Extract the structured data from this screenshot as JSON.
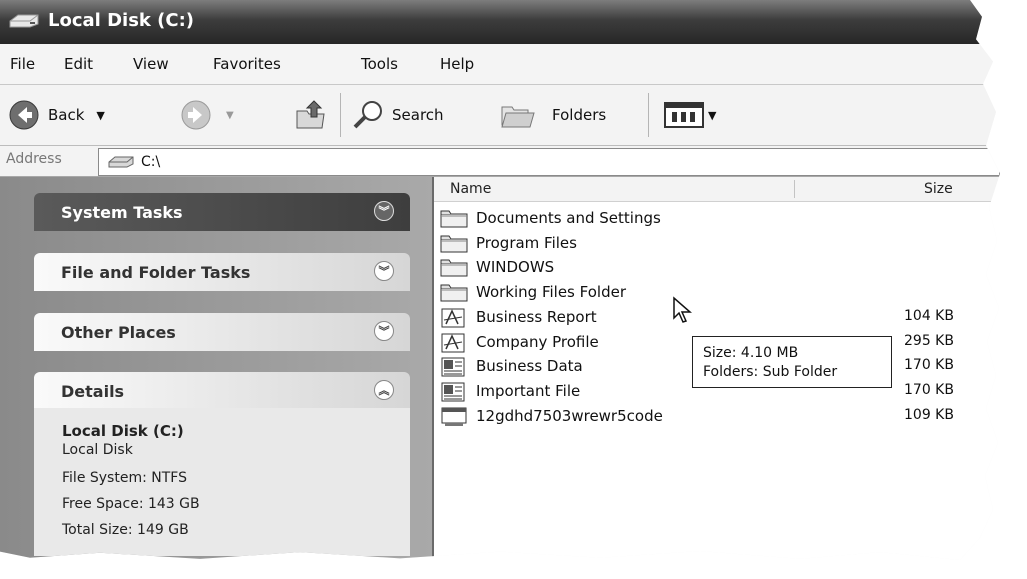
{
  "window": {
    "title": "Local Disk (C:)"
  },
  "menu": [
    "File",
    "Edit",
    "View",
    "Favorites",
    "Tools",
    "Help"
  ],
  "toolbar": {
    "back_label": "Back",
    "search_label": "Search",
    "folders_label": "Folders"
  },
  "address": {
    "label": "Address",
    "value": "C:\\"
  },
  "tasks": {
    "system_tasks": "System Tasks",
    "file_folder_tasks": "File and Folder Tasks",
    "other_places": "Other Places",
    "details": "Details"
  },
  "details": {
    "name": "Local Disk (C:)",
    "type": "Local Disk",
    "file_system": "File System: NTFS",
    "free_space": "Free Space: 143 GB",
    "total_size": "Total Size: 149 GB"
  },
  "columns": {
    "name": "Name",
    "size": "Size"
  },
  "files": [
    {
      "name": "Documents and Settings",
      "size": "",
      "icon": "folder-icon"
    },
    {
      "name": "Program Files",
      "size": "",
      "icon": "folder-icon"
    },
    {
      "name": "WINDOWS",
      "size": "",
      "icon": "folder-icon"
    },
    {
      "name": "Working Files Folder",
      "size": "",
      "icon": "folder-icon"
    },
    {
      "name": "Business Report",
      "size": "104 KB",
      "icon": "pdf-icon"
    },
    {
      "name": "Company Profile",
      "size": "295 KB",
      "icon": "pdf-icon"
    },
    {
      "name": "Business Data",
      "size": "170 KB",
      "icon": "document-icon"
    },
    {
      "name": "Important File",
      "size": "170 KB",
      "icon": "document-icon"
    },
    {
      "name": "12gdhd7503wrewr5code",
      "size": "109 KB",
      "icon": "executable-icon"
    }
  ],
  "tooltip": {
    "size": "Size: 4.10 MB",
    "folders": "Folders: Sub Folder"
  }
}
